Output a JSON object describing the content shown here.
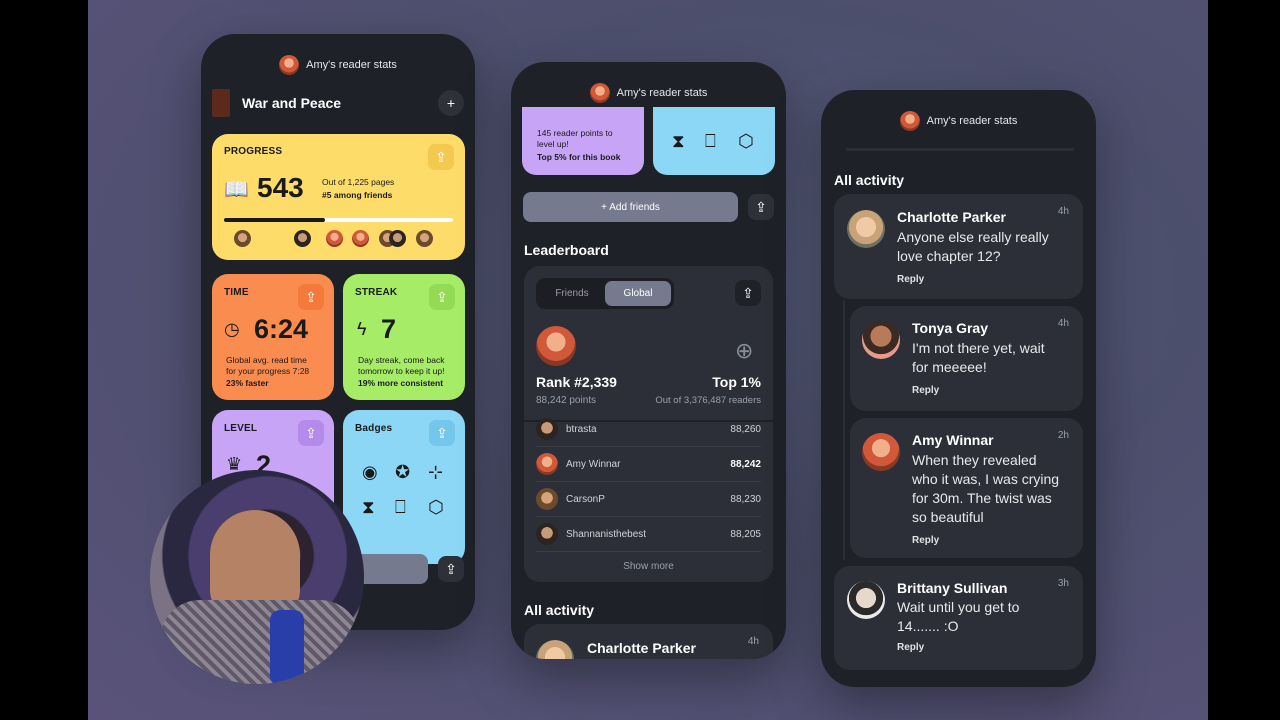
{
  "header_title": "Amy's reader stats",
  "phone1": {
    "book_title": "War and Peace",
    "plus": "+",
    "progress": {
      "label": "PROGRESS",
      "value": "543",
      "out_of": "Out of 1,225 pages",
      "rank": "#5 among friends",
      "fraction": 0.443
    },
    "time": {
      "label": "TIME",
      "value": "6:24",
      "line1": "Global avg. read time",
      "line2": "for your progress 7:28",
      "bold": "23% faster"
    },
    "streak": {
      "label": "STREAK",
      "value": "7",
      "line1": "Day streak, come back",
      "line2": "tomorrow to keep it up!",
      "bold": "19% more consistent"
    },
    "level": {
      "label": "LEVEL",
      "value": "2"
    },
    "badges": {
      "label": "Badges"
    }
  },
  "phone2": {
    "points_line1": "145 reader points to",
    "points_line2": "level up!",
    "points_bold": "Top 5% for this book",
    "add_friends": "+ Add friends",
    "leaderboard_title": "Leaderboard",
    "tabs": [
      "Friends",
      "Global"
    ],
    "rank": "Rank #2,339",
    "points": "88,242 points",
    "top": "Top 1%",
    "out_of": "Out of 3,376,487 readers",
    "rows": [
      {
        "name": "btrasta",
        "value": "88,260"
      },
      {
        "name": "Amy Winnar",
        "value": "88,242"
      },
      {
        "name": "CarsonP",
        "value": "88,230"
      },
      {
        "name": "Shannanisthebest",
        "value": "88,205"
      }
    ],
    "show_more": "Show more",
    "all_activity": "All activity",
    "preview_name": "Charlotte Parker",
    "preview_time": "4h"
  },
  "phone3": {
    "all_activity": "All activity",
    "items": [
      {
        "name": "Charlotte Parker",
        "time": "4h",
        "lines": [
          "Anyone else really really",
          "love chapter 12?"
        ],
        "reply": "Reply"
      },
      {
        "name": "Tonya Gray",
        "time": "4h",
        "lines": [
          "I'm not there yet, wait",
          "for meeeee!"
        ],
        "reply": "Reply"
      },
      {
        "name": "Amy Winnar",
        "time": "2h",
        "lines": [
          "When they revealed",
          "who it was, I was crying",
          "for 30m. The twist was",
          "so beautiful"
        ],
        "reply": "Reply"
      },
      {
        "name": "Brittany Sullivan",
        "time": "3h",
        "lines": [
          "Wait until you get to",
          "14....... :O"
        ],
        "reply": "Reply"
      }
    ]
  },
  "colors": {
    "yellow": "#fddc6a",
    "orange": "#fb8c4f",
    "green": "#a6ec67",
    "purple": "#c8a4f7",
    "blue": "#8cd6f6",
    "phone_bg": "#1f2128"
  }
}
